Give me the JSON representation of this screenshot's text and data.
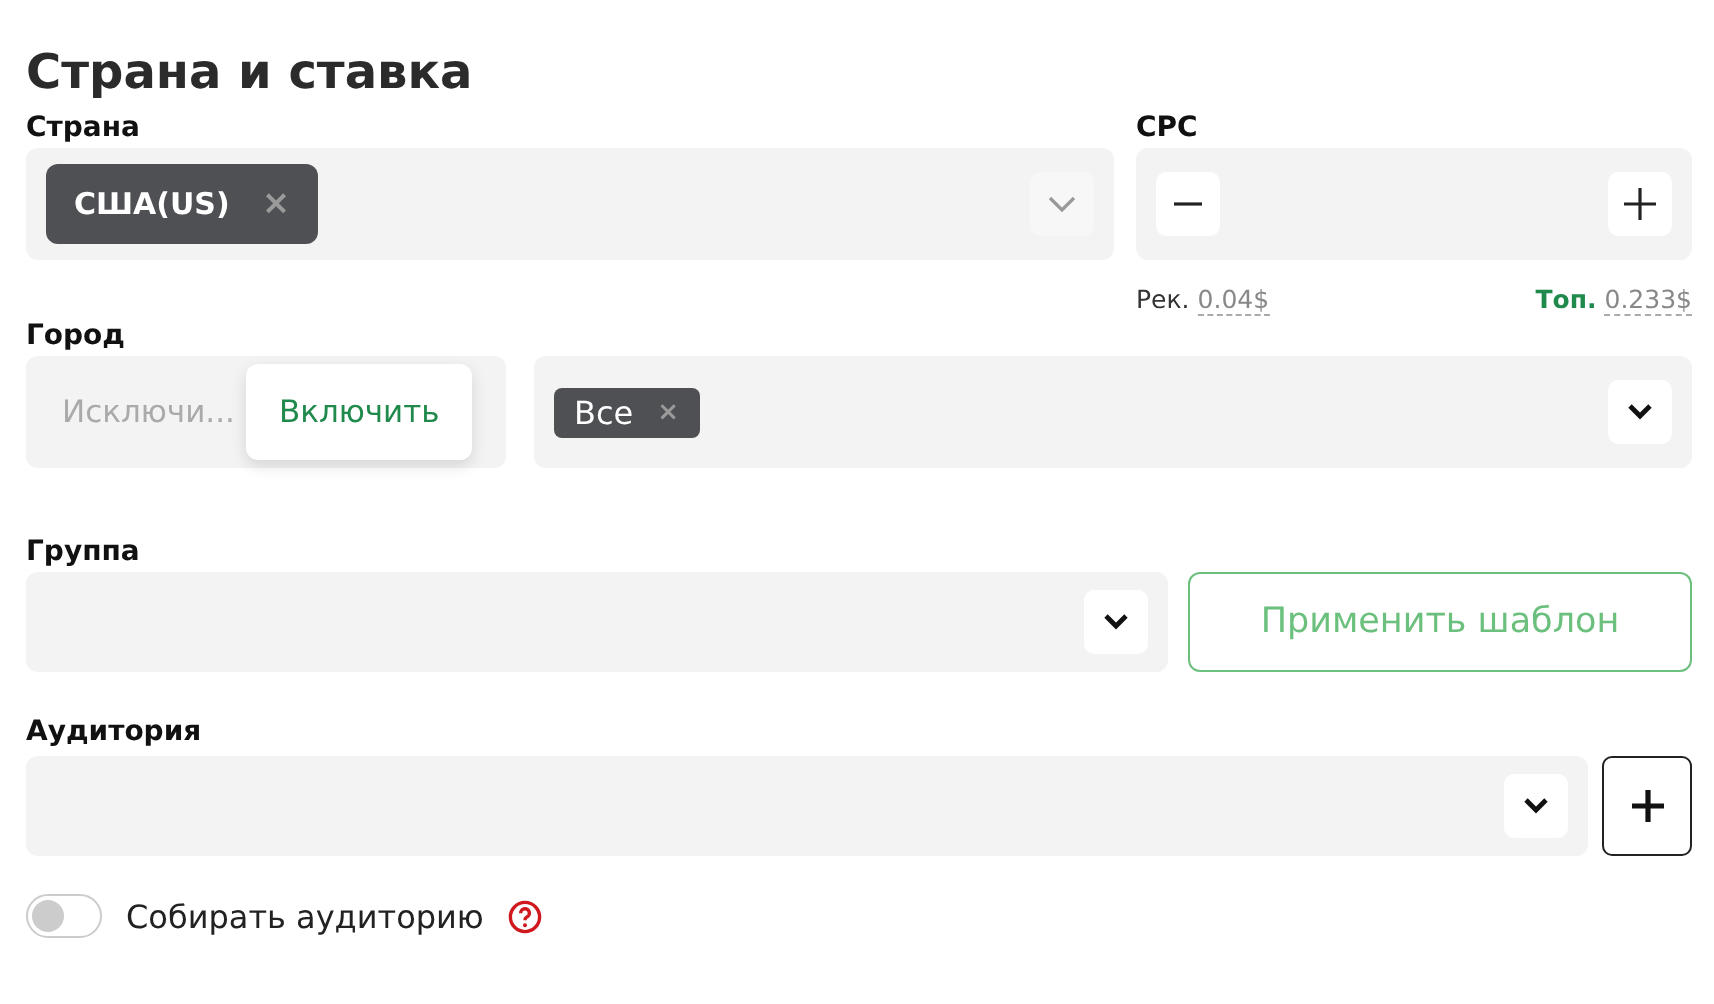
{
  "title": "Страна и ставка",
  "country": {
    "label": "Страна",
    "tags": [
      {
        "text": "США(US)",
        "remove": "×"
      }
    ]
  },
  "cpc": {
    "label": "CPC",
    "rec_label": "Рек.",
    "rec_value": "0.04$",
    "top_label": "Топ.",
    "top_value": "0.233$"
  },
  "city": {
    "label": "Город",
    "modes": [
      {
        "label": "Исключи...",
        "selected": false
      },
      {
        "label": "Включить",
        "selected": true
      }
    ],
    "tags": [
      {
        "text": "Все",
        "remove": "×"
      }
    ]
  },
  "group": {
    "label": "Группа",
    "button": "Применить шаблон"
  },
  "audience": {
    "label": "Аудитория"
  },
  "collect": {
    "label": "Собирать аудиторию",
    "on": false
  }
}
